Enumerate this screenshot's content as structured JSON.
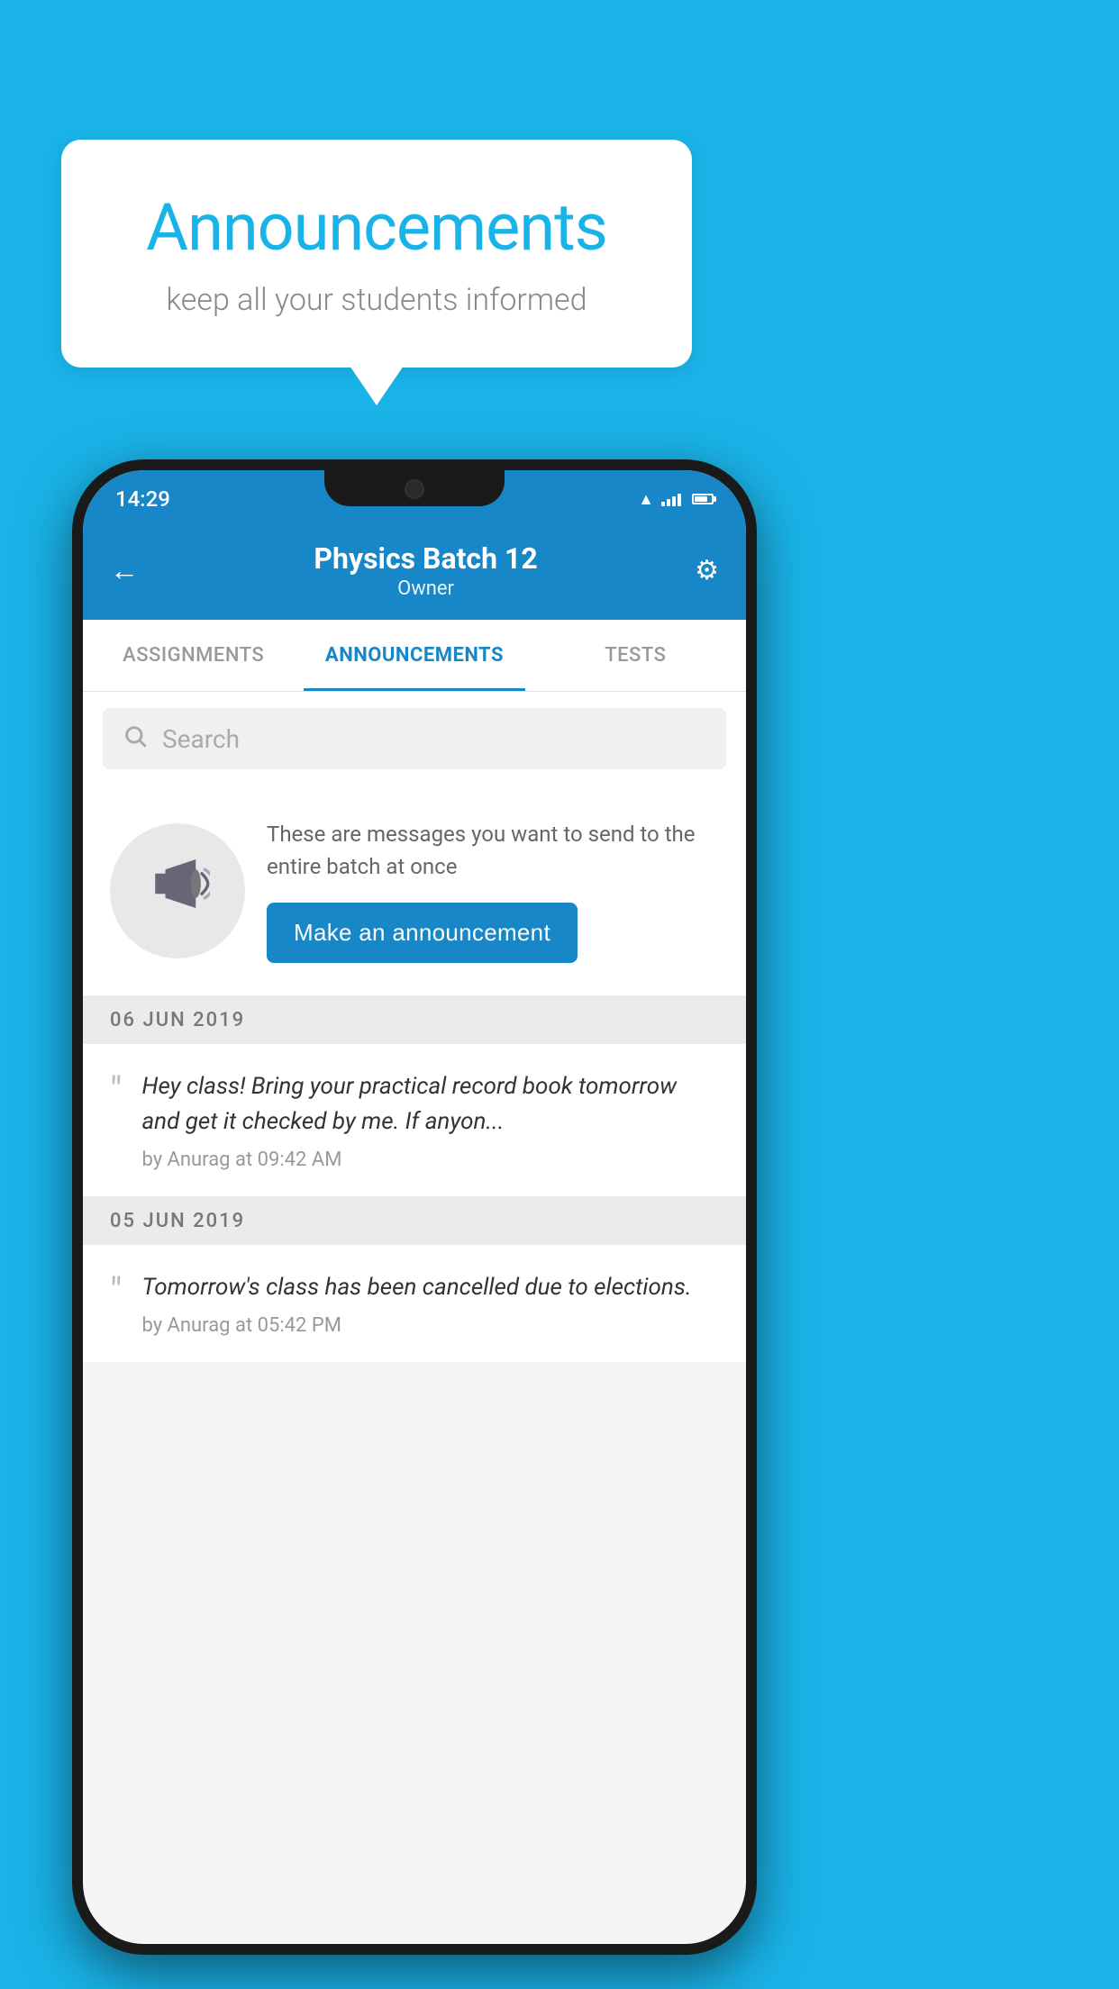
{
  "background_color": "#1ab3e8",
  "speech_bubble": {
    "title": "Announcements",
    "subtitle": "keep all your students informed"
  },
  "phone": {
    "status_bar": {
      "time": "14:29"
    },
    "app_bar": {
      "title": "Physics Batch 12",
      "subtitle": "Owner",
      "back_label": "←",
      "settings_label": "⚙"
    },
    "tabs": [
      {
        "label": "ASSIGNMENTS",
        "active": false
      },
      {
        "label": "ANNOUNCEMENTS",
        "active": true
      },
      {
        "label": "TESTS",
        "active": false
      }
    ],
    "search": {
      "placeholder": "Search"
    },
    "promo": {
      "description": "These are messages you want to send to the entire batch at once",
      "button_label": "Make an announcement"
    },
    "announcements": [
      {
        "date": "06  JUN  2019",
        "text": "Hey class! Bring your practical record book tomorrow and get it checked by me. If anyon...",
        "meta": "by Anurag at 09:42 AM"
      },
      {
        "date": "05  JUN  2019",
        "text": "Tomorrow's class has been cancelled due to elections.",
        "meta": "by Anurag at 05:42 PM"
      }
    ]
  }
}
